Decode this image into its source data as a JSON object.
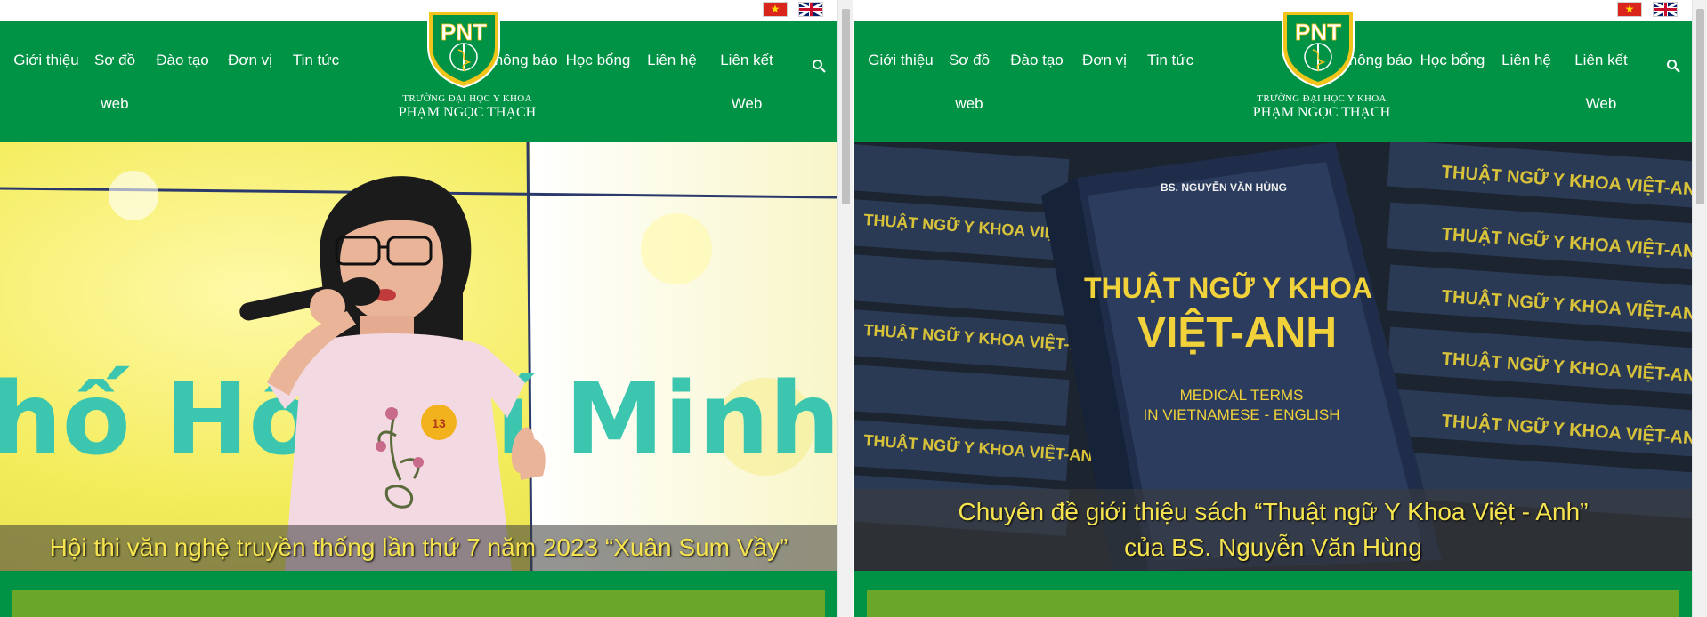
{
  "lang_flags": [
    {
      "name": "vietnamese-flag",
      "color": "#da251d"
    },
    {
      "name": "english-flag",
      "color": "#012169"
    }
  ],
  "nav": {
    "left": [
      {
        "lines": [
          "Giới thiệu"
        ]
      },
      {
        "lines": [
          "Sơ đồ",
          "web"
        ]
      },
      {
        "lines": [
          "Đào tạo"
        ]
      },
      {
        "lines": [
          "Đơn vị"
        ]
      },
      {
        "lines": [
          "Tin tức"
        ]
      }
    ],
    "right": [
      {
        "lines": [
          "Thông báo"
        ]
      },
      {
        "lines": [
          "Học bổng"
        ]
      },
      {
        "lines": [
          "Liên hệ"
        ]
      },
      {
        "lines": [
          "Liên kết",
          "Web"
        ]
      }
    ],
    "search_icon": "search-icon"
  },
  "logo": {
    "mark": "PNT",
    "line1": "TRƯỜNG ĐẠI HỌC Y KHOA",
    "line2": "PHẠM NGỌC THẠCH"
  },
  "colors": {
    "nav_green": "#009245",
    "caption_yellow": "#f5e34f",
    "section_bar": "#6aa628"
  },
  "slides": {
    "left": {
      "caption": "Hội thi văn nghệ truyền thống lần thứ 7 năm 2023 “Xuân Sum Vầy”",
      "background_text": "hố Hồ Chí Minh, ng",
      "badge": "13"
    },
    "right": {
      "caption_line1": "Chuyên đề giới thiệu sách “Thuật ngữ Y Khoa Việt - Anh”",
      "caption_line2": "của BS. Nguyễn Văn Hùng",
      "book_author": "BS. NGUYỄN VĂN HÙNG",
      "book_title1": "THUẬT NGỮ Y KHOA",
      "book_title2": "VIỆT-ANH",
      "book_sub1": "MEDICAL TERMS",
      "book_sub2": "IN VIETNAMESE - ENGLISH",
      "spine_text": "THUẬT NGỮ Y KHOA VIỆT-ANH"
    }
  }
}
